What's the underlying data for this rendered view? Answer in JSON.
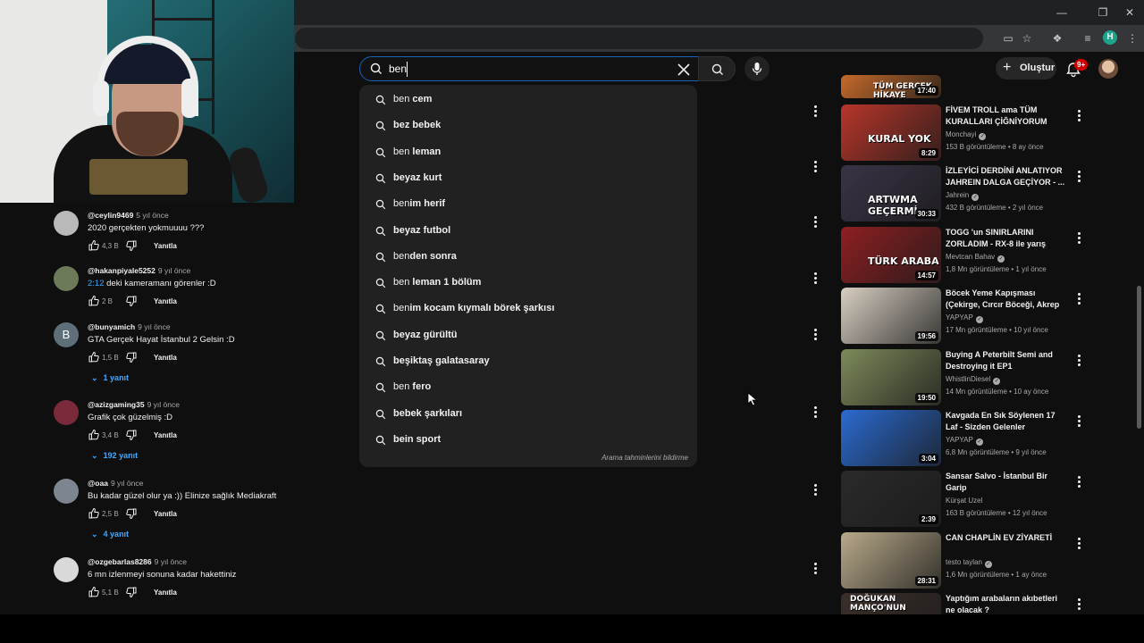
{
  "search": {
    "query": "ben",
    "suggestions": [
      {
        "prefix": "ben",
        "rest": " cem"
      },
      {
        "prefix": "",
        "rest": "bez bebek"
      },
      {
        "prefix": "ben",
        "rest": " leman"
      },
      {
        "prefix": "",
        "rest": "beyaz kurt"
      },
      {
        "prefix": "ben",
        "rest": "im herif"
      },
      {
        "prefix": "",
        "rest": "beyaz futbol"
      },
      {
        "prefix": "ben",
        "rest": "den sonra"
      },
      {
        "prefix": "ben",
        "rest": " leman 1 bölüm"
      },
      {
        "prefix": "ben",
        "rest": "im kocam kıymalı börek şarkısı"
      },
      {
        "prefix": "",
        "rest": "beyaz gürültü"
      },
      {
        "prefix": "",
        "rest": "beşiktaş galatasaray"
      },
      {
        "prefix": "ben",
        "rest": " fero"
      },
      {
        "prefix": "",
        "rest": "bebek şarkıları"
      },
      {
        "prefix": "",
        "rest": "bein sport"
      }
    ],
    "report_label": "Arama tahminlerini bildirme"
  },
  "header": {
    "create_label": "Oluştur",
    "notifications_badge": "9+",
    "profile_letter": "H"
  },
  "comments": [
    {
      "user": "@ceylin9469",
      "time": "5 yıl önce",
      "timestamp": "",
      "text": "2020 gerçekten yokmuuuu ???",
      "likes": "4,3 B",
      "reply_label": "Yanıtla",
      "replies": "",
      "avatar_letter": "",
      "avatar_color": "#b9b9b9"
    },
    {
      "user": "@hakanpiyale5252",
      "time": "9 yıl önce",
      "timestamp": "2:12",
      "text": " deki kameramanı görenler :D",
      "likes": "2 B",
      "reply_label": "Yanıtla",
      "replies": "",
      "avatar_letter": "",
      "avatar_color": "#6d7a5a"
    },
    {
      "user": "@bunyamich",
      "time": "9 yıl önce",
      "timestamp": "",
      "text": "GTA Gerçek Hayat İstanbul 2 Gelsin :D",
      "likes": "1,5 B",
      "reply_label": "Yanıtla",
      "replies": "1 yanıt",
      "avatar_letter": "B",
      "avatar_color": "#5f6f7a"
    },
    {
      "user": "@azizgaming35",
      "time": "9 yıl önce",
      "timestamp": "",
      "text": "Grafik çok güzelmiş :D",
      "likes": "3,4 B",
      "reply_label": "Yanıtla",
      "replies": "192 yanıt",
      "avatar_letter": "",
      "avatar_color": "#7a2a3a"
    },
    {
      "user": "@oaa",
      "time": "9 yıl önce",
      "timestamp": "",
      "text": "Bu kadar güzel olur ya :)) Elinize sağlık Mediakraft",
      "likes": "2,5 B",
      "reply_label": "Yanıtla",
      "replies": "4 yanıt",
      "avatar_letter": "",
      "avatar_color": "#7d8690"
    },
    {
      "user": "@ozgebarlas8286",
      "time": "9 yıl önce",
      "timestamp": "",
      "text": "6 mn izlenmeyi sonuna kadar hakettiniz",
      "likes": "5,1 B",
      "reply_label": "Yanıtla",
      "replies": "",
      "avatar_letter": "",
      "avatar_color": "#d9d9d9"
    }
  ],
  "recommended": [
    {
      "title": "",
      "channel": "",
      "verified": false,
      "meta": "",
      "duration": "17:40",
      "thumb_text": "TÜM GERÇEK HİKAYE",
      "thumb_color": "#c46a2a"
    },
    {
      "title": "FİVEM TROLL ama TÜM KURALLARI ÇİĞNİYORUM",
      "channel": "Monchayi",
      "verified": true,
      "meta": "153 B görüntüleme • 8 ay önce",
      "duration": "8:29",
      "thumb_text": "KURAL YOK",
      "thumb_color": "#b8362b"
    },
    {
      "title": "İZLEYİCİ DERDİNİ ANLATIYOR JAHREIN DALGA GEÇİYOR - ...",
      "channel": "Jahrein",
      "verified": true,
      "meta": "432 B görüntüleme • 2 yıl önce",
      "duration": "30:33",
      "thumb_text": "ARTWMA GEÇERMİ",
      "thumb_color": "#3a3346"
    },
    {
      "title": "TOGG 'un SINIRLARINI ZORLADIM - RX-8 ile yarış",
      "channel": "Mevtcan Bahav",
      "verified": true,
      "meta": "1,8 Mn görüntüleme • 1 yıl önce",
      "duration": "14:57",
      "thumb_text": "TÜRK ARABA",
      "thumb_color": "#8e1f22"
    },
    {
      "title": "Böcek Yeme Kapışması (Çekirge, Cırcır Böceği, Akrep ...",
      "channel": "YAPYAP",
      "verified": true,
      "meta": "17 Mn görüntüleme • 10 yıl önce",
      "duration": "19:56",
      "thumb_text": "",
      "thumb_color": "#d8cfc2"
    },
    {
      "title": "Buying A Peterbilt Semi and Destroying it EP1",
      "channel": "WhistlinDiesel",
      "verified": true,
      "meta": "14 Mn görüntüleme • 10 ay önce",
      "duration": "19:50",
      "thumb_text": "",
      "thumb_color": "#7d8a5a"
    },
    {
      "title": "Kavgada En Sık Söylenen 17 Laf - Sizden Gelenler",
      "channel": "YAPYAP",
      "verified": true,
      "meta": "6,8 Mn görüntüleme • 9 yıl önce",
      "duration": "3:04",
      "thumb_text": "",
      "thumb_color": "#2b6bd0"
    },
    {
      "title": "Sansar Salvo - İstanbul Bir Garip",
      "channel": "Kürşat Uzel",
      "verified": false,
      "meta": "163 B görüntüleme • 12 yıl önce",
      "duration": "2:39",
      "thumb_text": "",
      "thumb_color": "#2a2a2a"
    },
    {
      "title": "CAN CHAPLİN EV ZİYARETİ",
      "channel": "testo taylan",
      "verified": true,
      "meta": "1,6 Mn görüntüleme • 1 ay önce",
      "duration": "28:31",
      "thumb_text": "",
      "thumb_color": "#b8a98a"
    },
    {
      "title": "Yaptığım arabaların akıbetleri ne olacak ?",
      "channel": "",
      "verified": false,
      "meta": "",
      "duration": "",
      "thumb_text": "DOĞUKAN MANÇO'NUN",
      "thumb_color": "#3a2f2a"
    }
  ]
}
